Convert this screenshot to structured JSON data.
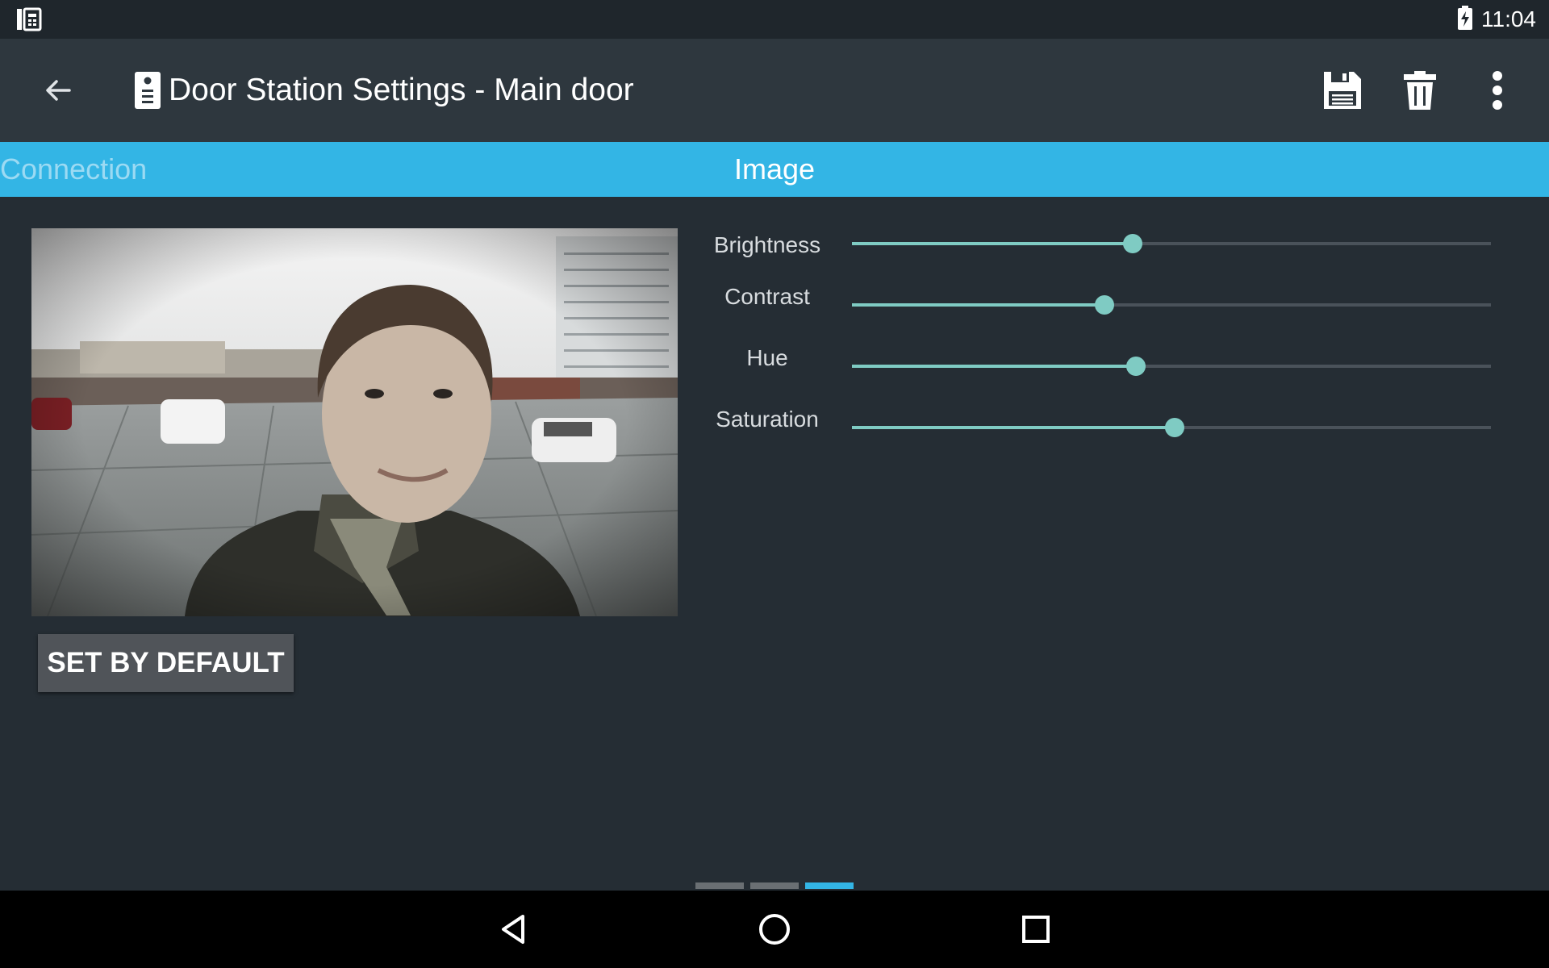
{
  "status_bar": {
    "time": "11:04",
    "left_icon": "intercom-notification-icon",
    "battery_icon": "battery-charging-icon"
  },
  "app_bar": {
    "back_icon": "arrow-back-icon",
    "title_icon": "door-station-icon",
    "title": "Door Station Settings - Main door",
    "actions": [
      "save-icon",
      "delete-icon",
      "more-vert-icon"
    ]
  },
  "tabs": {
    "items": [
      {
        "label": "Connection",
        "selected": false
      },
      {
        "label": "Image",
        "selected": true
      }
    ]
  },
  "preview": {
    "description_icon": "camera-preview-image"
  },
  "buttons": {
    "set_default": "SET BY DEFAULT"
  },
  "sliders": [
    {
      "label": "Brightness",
      "value": 0.44
    },
    {
      "label": "Contrast",
      "value": 0.395
    },
    {
      "label": "Hue",
      "value": 0.445
    },
    {
      "label": "Saturation",
      "value": 0.505
    }
  ],
  "page_indicator": {
    "count": 3,
    "active_index": 2
  },
  "colors": {
    "accent": "#33b5e5",
    "slider": "#7fcbc3",
    "background": "#252d34",
    "app_bar": "#2e373e"
  },
  "nav_bar": [
    "nav-back-icon",
    "nav-home-icon",
    "nav-recents-icon"
  ]
}
